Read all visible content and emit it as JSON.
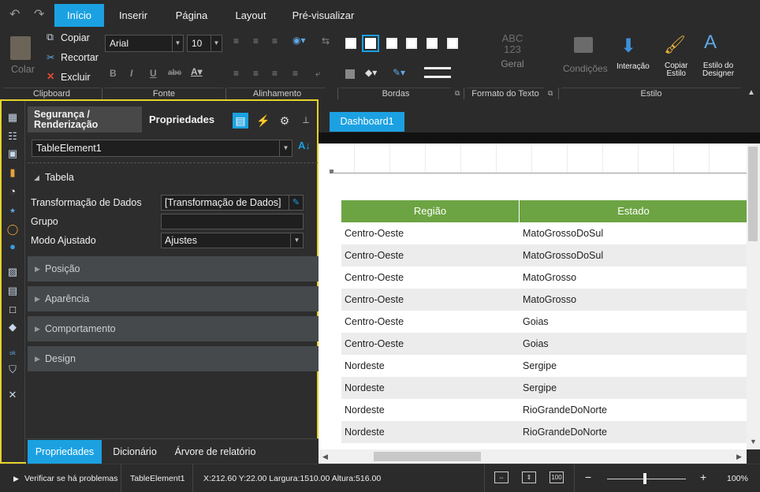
{
  "tabs": [
    "Início",
    "Inserir",
    "Página",
    "Layout",
    "Pré-visualizar"
  ],
  "ribbon": {
    "clipboard": {
      "paste": "Colar",
      "copy": "Copiar",
      "cut": "Recortar",
      "delete": "Excluir"
    },
    "font": {
      "name": "Arial",
      "size": "10"
    },
    "number_format": {
      "sample": "ABC\n123",
      "label": "Geral"
    },
    "conditions": "Condições",
    "interaction": "Interação",
    "copy_style": "Copiar\nEstilo",
    "designer_style": "Estilo do\nDesigner",
    "groups": [
      "Clipboard",
      "Fonte",
      "Alinhamento",
      "Bordas",
      "Formato do Texto",
      "Estilo"
    ]
  },
  "panel": {
    "tab_security": "Segurança /\nRenderização",
    "tab_properties": "Propriedades",
    "element": "TableElement1",
    "section": "Tabela",
    "properties": [
      {
        "label": "Transformação de Dados",
        "value": "[Transformação de Dados]"
      },
      {
        "label": "Grupo",
        "value": ""
      },
      {
        "label": "Modo Ajustado",
        "value": "Ajustes"
      }
    ],
    "categories": [
      "Posição",
      "Aparência",
      "Comportamento",
      "Design"
    ],
    "bottom_tabs": [
      "Propriedades",
      "Dicionário",
      "Árvore de relatório"
    ]
  },
  "document_tab": "Dashboard1",
  "table": {
    "headers": [
      "Região",
      "Estado"
    ],
    "rows": [
      [
        "Centro-Oeste",
        "MatoGrossoDoSul"
      ],
      [
        "Centro-Oeste",
        "MatoGrossoDoSul"
      ],
      [
        "Centro-Oeste",
        "MatoGrosso"
      ],
      [
        "Centro-Oeste",
        "MatoGrosso"
      ],
      [
        "Centro-Oeste",
        "Goias"
      ],
      [
        "Centro-Oeste",
        "Goias"
      ],
      [
        "Nordeste",
        "Sergipe"
      ],
      [
        "Nordeste",
        "Sergipe"
      ],
      [
        "Nordeste",
        "RioGrandeDoNorte"
      ],
      [
        "Nordeste",
        "RioGrandeDoNorte"
      ]
    ],
    "header_color": "#6ca443"
  },
  "status": {
    "check": "Verificar se há problemas",
    "element": "TableElement1",
    "geometry": "X:212.60 Y:22.00 Largura:1510.00 Altura:516.00",
    "zoom": "100%"
  },
  "colors": {
    "accent": "#1ba1e2",
    "focus": "#e6d22b"
  }
}
